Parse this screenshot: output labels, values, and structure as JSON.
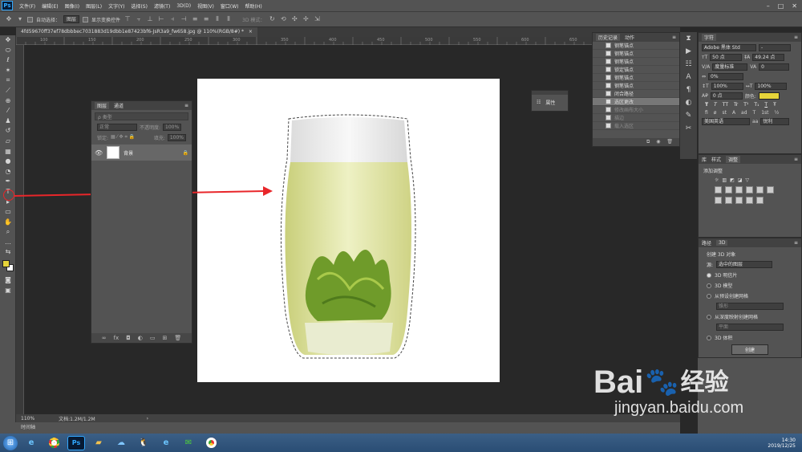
{
  "menubar": {
    "app_icon": "Ps",
    "items": [
      "文件(F)",
      "编辑(E)",
      "图像(I)",
      "图层(L)",
      "文字(Y)",
      "选择(S)",
      "滤镜(T)",
      "3D(D)",
      "视图(V)",
      "窗口(W)",
      "帮助(H)"
    ],
    "window_controls": [
      "–",
      "□",
      "✕"
    ]
  },
  "options_bar": {
    "auto_select_label": "自动选择：",
    "auto_select_value": "图层",
    "show_transform_label": "显示变换控件",
    "mode_3d_label": "3D 模式："
  },
  "document_tab": {
    "title": "4fd59670ff37ef78dbbbec7031883d19dbb1e87423bf6-JsR3a9_fw658.jpg @ 110%(RGB/8#) *",
    "close": "×"
  },
  "ruler_ticks": [
    "100",
    "150",
    "200",
    "250",
    "300",
    "350",
    "400",
    "450",
    "500",
    "550",
    "600",
    "650",
    "700"
  ],
  "status": {
    "zoom": "110%",
    "doc_size": "文档:1.2M/1.2M"
  },
  "timeline_label": "时间轴",
  "layers_panel": {
    "tabs": [
      "图层",
      "通道"
    ],
    "filter_placeholder": "ρ 类型",
    "blend_mode": "正常",
    "opacity_label": "不透明度:",
    "opacity_value": "100%",
    "lock_label": "锁定:",
    "fill_label": "填充:",
    "fill_value": "100%",
    "layer_name": "背景"
  },
  "properties_panel": {
    "title": "属性"
  },
  "history_panel": {
    "tabs": [
      "历史记录",
      "动作"
    ],
    "items": [
      {
        "label": "钢笔锚点",
        "state": "normal"
      },
      {
        "label": "钢笔锚点",
        "state": "normal"
      },
      {
        "label": "钢笔锚点",
        "state": "normal"
      },
      {
        "label": "锁定锚点",
        "state": "normal"
      },
      {
        "label": "钢笔锚点",
        "state": "normal"
      },
      {
        "label": "钢笔锚点",
        "state": "normal"
      },
      {
        "label": "闭合路径",
        "state": "normal"
      },
      {
        "label": "选区更改",
        "state": "current"
      },
      {
        "label": "修改画布大小",
        "state": "dim"
      },
      {
        "label": "描边",
        "state": "dim"
      },
      {
        "label": "载入选区",
        "state": "dim"
      }
    ]
  },
  "character_panel": {
    "title": "字符",
    "font_family": "Adobe 黑体 Std",
    "font_style": "-",
    "font_size": "50 点",
    "leading": "49.24 点",
    "kerning": "度量标准",
    "tracking": "0",
    "tsume": "0%",
    "vscale": "100%",
    "hscale": "100%",
    "baseline": "0 点",
    "color_label": "颜色:",
    "color": "#e6d43a",
    "language": "美国英语",
    "antialias": "锐利",
    "style_buttons": [
      "T",
      "T",
      "TT",
      "Tr",
      "T¹",
      "T₁",
      "T",
      "Ŧ"
    ]
  },
  "adjustments_panel": {
    "tabs": [
      "库",
      "样式",
      "调整"
    ],
    "add_label": "添加调整"
  },
  "panel_3d": {
    "tabs": [
      "路径",
      "3D"
    ],
    "header": "创建 3D 对象",
    "source_label": "源:",
    "source_value": "选中的图层",
    "options": [
      "3D 明信片",
      "3D 模型",
      "从预设创建网格",
      "从深度映射创建网格",
      "3D 体积"
    ],
    "sub_value_1": "锥形",
    "sub_value_2": "平面",
    "create_button": "创建"
  },
  "taskbar": {
    "time": "14:30",
    "date": "2019/12/25",
    "ps_icon": "Ps"
  },
  "watermark": {
    "brand": "Bai",
    "brand_tail": "经验",
    "url": "jingyan.baidu.com"
  },
  "colors": {
    "foreground": "#e6d43a",
    "background": "#ffffff",
    "arrow": "#e8262a"
  }
}
